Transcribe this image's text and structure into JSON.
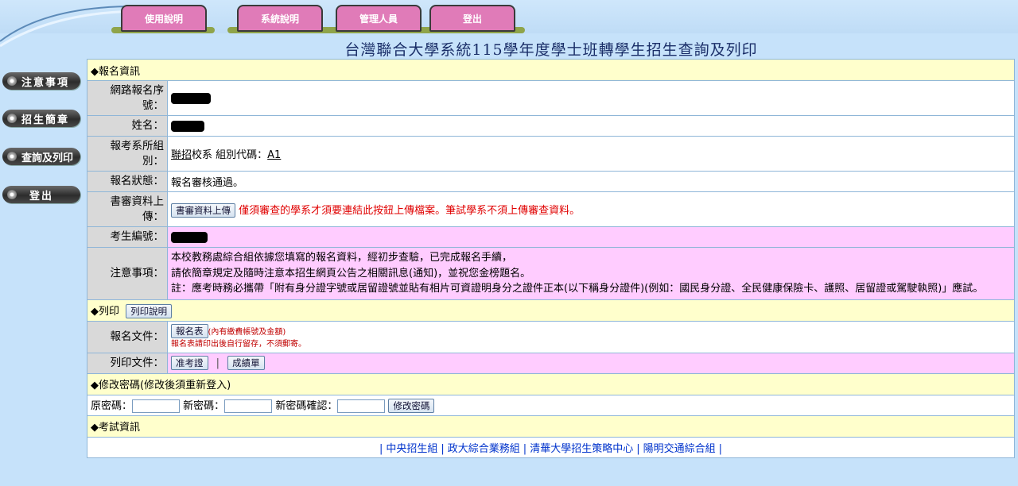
{
  "nav": {
    "tabs": [
      "使用說明",
      "系統說明",
      "管理人員",
      "登出"
    ]
  },
  "page_title": "台灣聯合大學系統115學年度學士班轉學生招生查詢及列印",
  "sidebar": {
    "items": [
      {
        "label": "注意事項"
      },
      {
        "label": "招生簡章"
      },
      {
        "label": "查詢及列印"
      },
      {
        "label": "登出"
      }
    ]
  },
  "registration": {
    "section_title": "◆報名資訊",
    "reg_no_label": "網路報名序號：",
    "name_label": "姓名：",
    "dept_label": "報考系所組別：",
    "dept_value_link": "聯招",
    "dept_value_text": "校系 組別代碼：",
    "dept_code": "A1",
    "status_label": "報名狀態：",
    "status_value": "報名審核通過。",
    "upload_label": "書審資料上傳：",
    "upload_button": "書審資料上傳",
    "upload_note": "僅須審查的學系才須要連結此按鈕上傳檔案。筆試學系不須上傳審查資料。",
    "exam_no_label": "考生編號：",
    "notice_label": "注意事項：",
    "notice_lines": [
      "本校教務處綜合組依據您填寫的報名資料，經初步查驗，已完成報名手續，",
      "請依簡章規定及隨時注意本招生網頁公告之相關訊息(通知)，並祝您金榜題名。",
      "註：應考時務必攜帶「附有身分證字號或居留證號並貼有相片可資證明身分之證件正本(以下稱身分證件)(例如：國民身分證、全民健康保險卡、護照、居留證或駕駛執照)」應試。"
    ]
  },
  "print": {
    "section_title": "◆列印",
    "help_button": "列印說明",
    "doc_label": "報名文件：",
    "form_button": "報名表",
    "form_note": "(內有繳費帳號及金額)",
    "form_note2": "報名表請印出後自行留存，不須郵寄。",
    "print_label": "列印文件：",
    "admit_button": "准考證",
    "divider": "|",
    "score_button": "成績單"
  },
  "password": {
    "section_title": "◆修改密碼(修改後須重新登入)",
    "old_label": "原密碼：",
    "new_label": "新密碼：",
    "confirm_label": "新密碼確認：",
    "submit_button": "修改密碼"
  },
  "exam_info": {
    "section_title": "◆考試資訊",
    "links": [
      "中央招生組",
      "政大綜合業務組",
      "清華大學招生策略中心",
      "陽明交通綜合組"
    ],
    "separator": "|"
  }
}
